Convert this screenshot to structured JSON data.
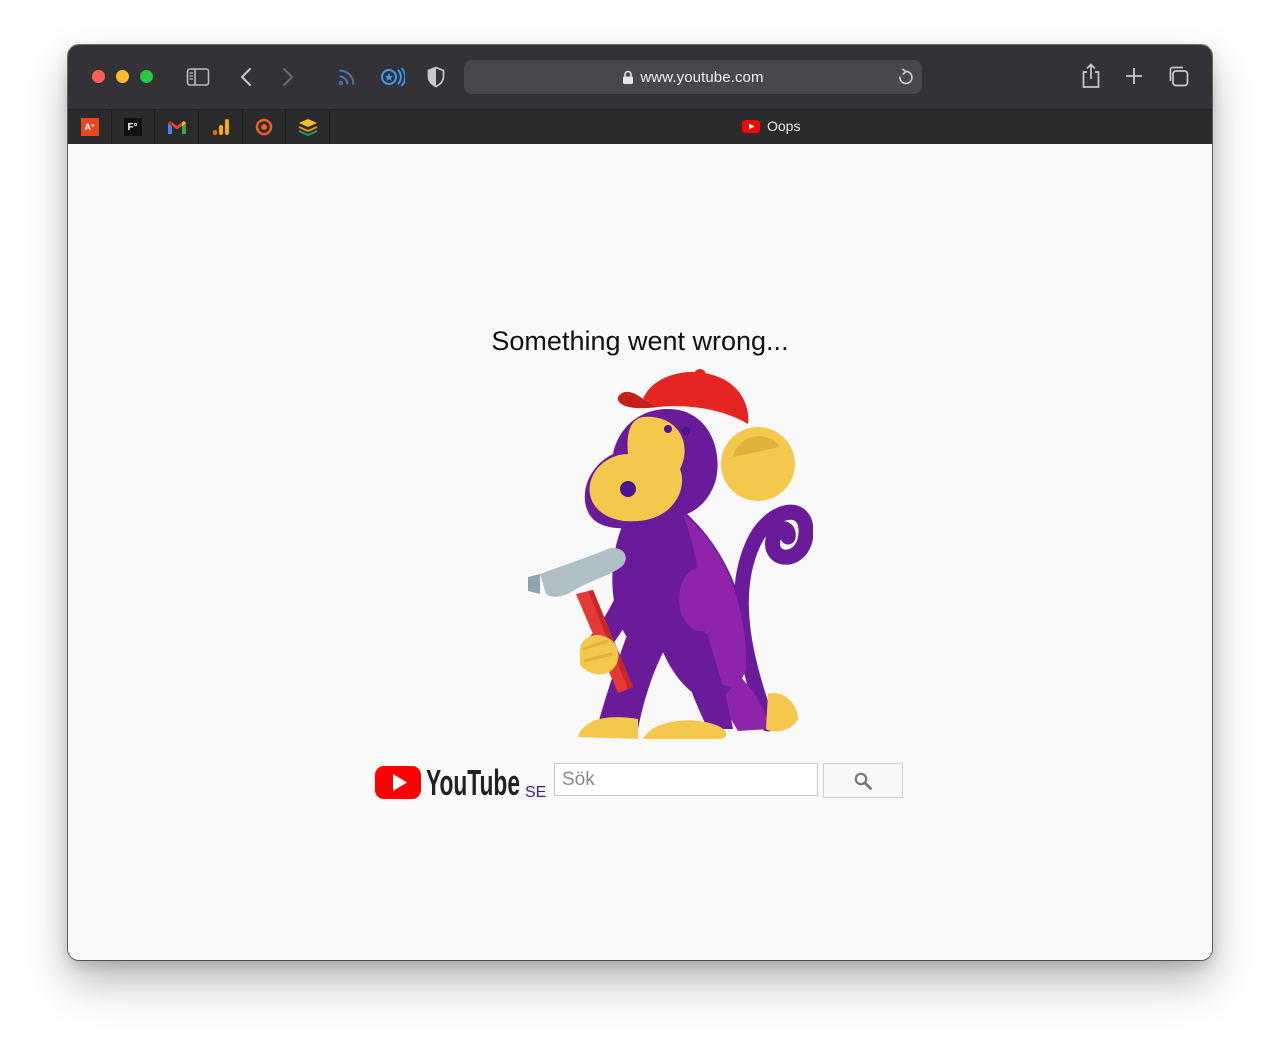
{
  "browser": {
    "url": "www.youtube.com",
    "active_tab_title": "Oops",
    "favorites": [
      {
        "label": "A°",
        "icon": "affinity-icon"
      },
      {
        "label": "F°",
        "icon": "fathom-icon"
      },
      {
        "label": "",
        "icon": "gmail-icon"
      },
      {
        "label": "",
        "icon": "analytics-icon"
      },
      {
        "label": "",
        "icon": "grafana-icon"
      },
      {
        "label": "",
        "icon": "layers-icon"
      }
    ],
    "colors": {
      "titlebar": "#333236",
      "tabbar": "#2b2a2d",
      "urlbar": "#48474b"
    }
  },
  "page": {
    "headline": "Something went wrong...",
    "brand": "YouTube",
    "country_code": "SE",
    "search_placeholder": "Sök",
    "colors": {
      "brand_red": "#ff0000",
      "country_code": "#3c1c8e",
      "background": "#f9f9f9"
    }
  }
}
